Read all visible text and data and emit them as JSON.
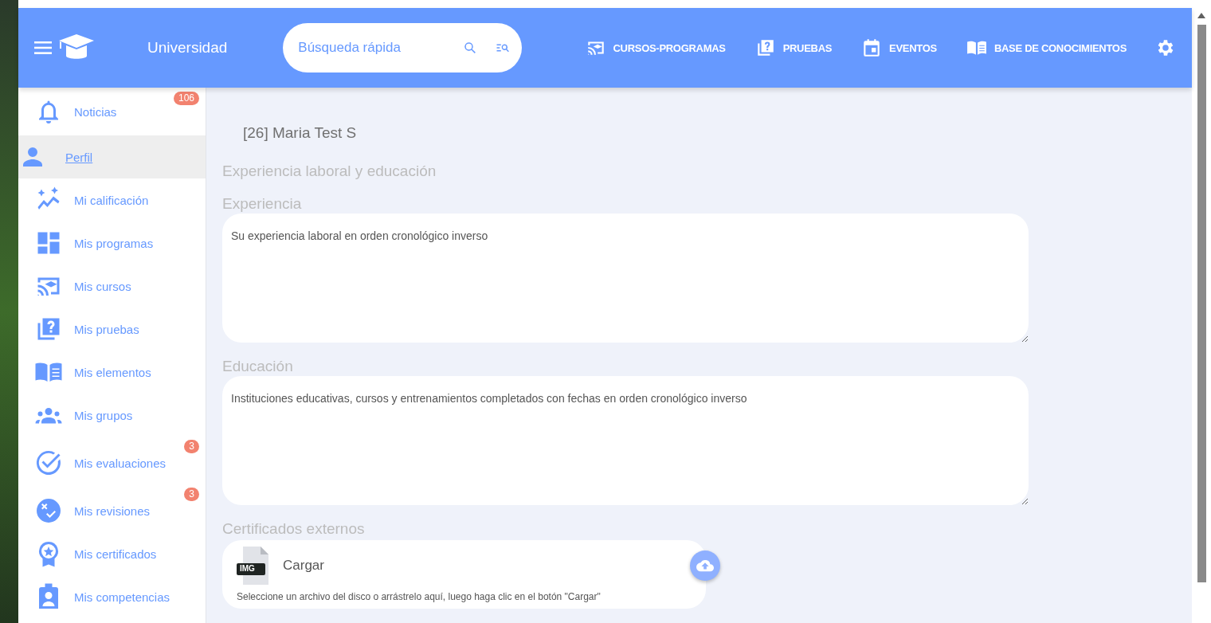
{
  "header": {
    "app_title": "Universidad",
    "search": {
      "placeholder": "Búsqueda rápida"
    },
    "nav": [
      {
        "label": "CURSOS-PROGRAMAS"
      },
      {
        "label": "PRUEBAS"
      },
      {
        "label": "EVENTOS"
      },
      {
        "label": "BASE DE CONOCIMIENTOS"
      }
    ]
  },
  "sidebar": {
    "items": [
      {
        "label": "Noticias",
        "badge": "106",
        "selected": false
      },
      {
        "label": "Perfil",
        "selected": true
      },
      {
        "label": "Mi calificación",
        "selected": false
      },
      {
        "label": "Mis programas",
        "selected": false
      },
      {
        "label": "Mis cursos",
        "selected": false
      },
      {
        "label": "Mis pruebas",
        "selected": false
      },
      {
        "label": "Mis elementos",
        "selected": false
      },
      {
        "label": "Mis grupos",
        "selected": false
      },
      {
        "label": "Mis evaluaciones",
        "badge": "3",
        "selected": false
      },
      {
        "label": "Mis revisiones",
        "badge": "3",
        "selected": false
      },
      {
        "label": "Mis certificados",
        "selected": false
      },
      {
        "label": "Mis competencias",
        "selected": false
      }
    ]
  },
  "main": {
    "user_title": "[26] Maria Test S",
    "section_title": "Experiencia laboral y educación",
    "fields": [
      {
        "label": "Experiencia",
        "placeholder": "Su experiencia laboral en orden cronológico inverso"
      },
      {
        "label": "Educación",
        "placeholder": "Instituciones educativas, cursos y entrenamientos completados con fechas en orden cronológico inverso"
      }
    ],
    "certificates": {
      "label": "Certificados externos",
      "file_tag": "IMG",
      "upload_label": "Cargar",
      "hint": "Seleccione un archivo del disco o arrástrelo aquí, luego haga clic en el botón \"Cargar\""
    }
  }
}
